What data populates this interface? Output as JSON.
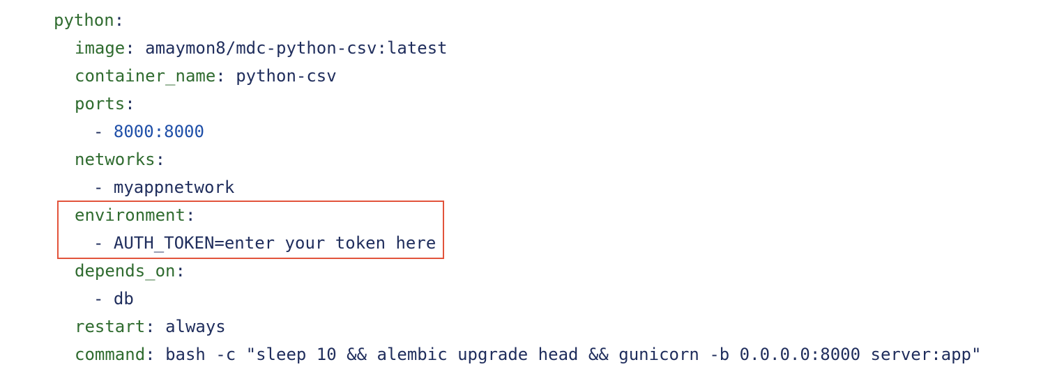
{
  "code": {
    "service": {
      "key": "python",
      "colon": ":"
    },
    "image": {
      "key": "image",
      "colon": ":",
      "value": "amaymon8/mdc-python-csv:latest"
    },
    "container_name": {
      "key": "container_name",
      "colon": ":",
      "value": "python-csv"
    },
    "ports": {
      "key": "ports",
      "colon": ":",
      "items": [
        "8000:8000"
      ]
    },
    "networks": {
      "key": "networks",
      "colon": ":",
      "items": [
        "myappnetwork"
      ]
    },
    "environment": {
      "key": "environment",
      "colon": ":",
      "items": [
        "AUTH_TOKEN=enter your token here"
      ]
    },
    "depends_on": {
      "key": "depends_on",
      "colon": ":",
      "items": [
        "db"
      ]
    },
    "restart": {
      "key": "restart",
      "colon": ":",
      "value": "always"
    },
    "command": {
      "key": "command",
      "colon": ":",
      "value": "bash -c \"sleep 10 && alembic upgrade head && gunicorn -b 0.0.0.0:8000 server:app\""
    },
    "dash": "- "
  },
  "colors": {
    "key": "#2f6b2f",
    "value": "#1f2d5c",
    "number": "#1f4fa8",
    "highlight_border": "#e2533b"
  }
}
